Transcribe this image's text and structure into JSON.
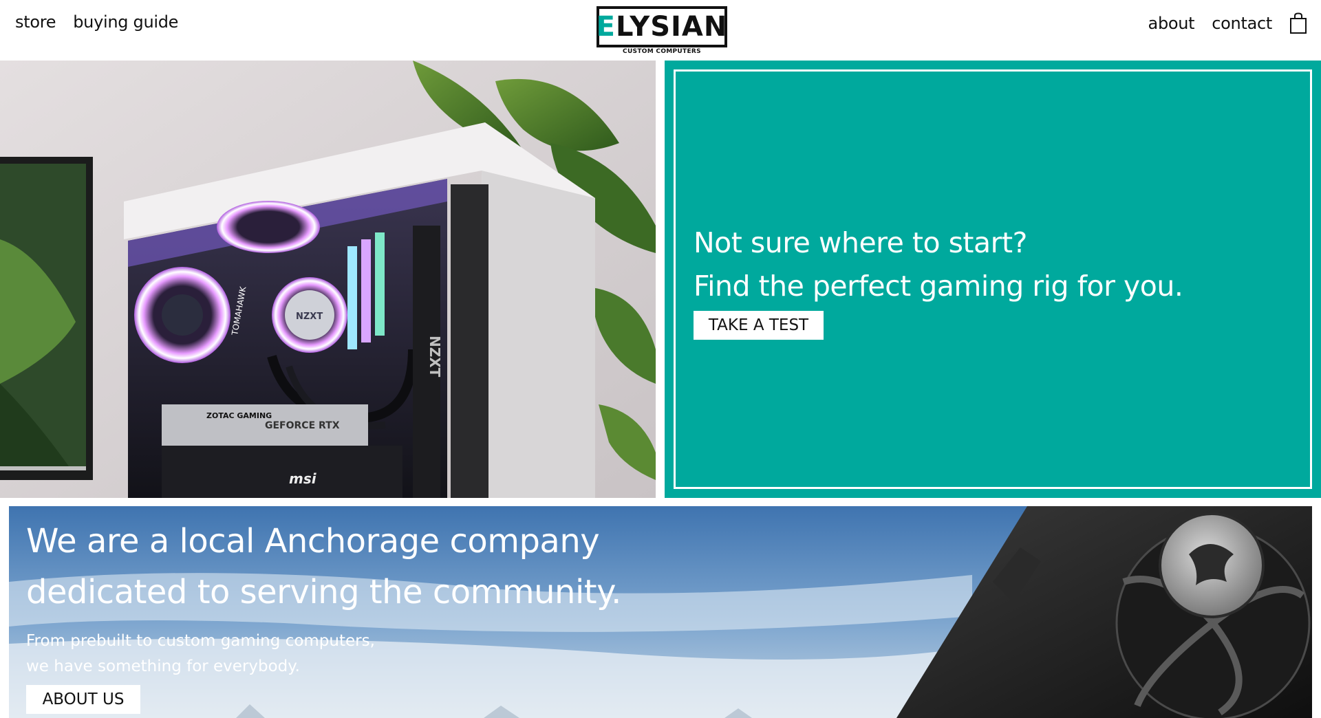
{
  "header": {
    "nav_left": [
      "store",
      "buying guide"
    ],
    "nav_right": [
      "about",
      "contact"
    ],
    "logo": {
      "first_letter": "E",
      "rest": "LYSIAN",
      "tagline": "CUSTOM COMPUTERS"
    },
    "cart_icon": "shopping-bag-icon"
  },
  "hero": {
    "image_brand_text": {
      "case": "NZXT",
      "cooler": "TOMAHAWK",
      "pump": "NZXT",
      "gpu": "ZOTAC GAMING",
      "gpu2": "GEFORCE RTX",
      "board": "msi"
    }
  },
  "teal_panel": {
    "line1": "Not sure where to start?",
    "line2": "Find the perfect gaming rig for you.",
    "button": "TAKE A TEST",
    "color": "#00a99d"
  },
  "banner": {
    "line1": "We are a local Anchorage company",
    "line2": "dedicated to serving the community.",
    "sub1": "From prebuilt to custom gaming computers,",
    "sub2": "we have something for everybody.",
    "button": "ABOUT US"
  }
}
